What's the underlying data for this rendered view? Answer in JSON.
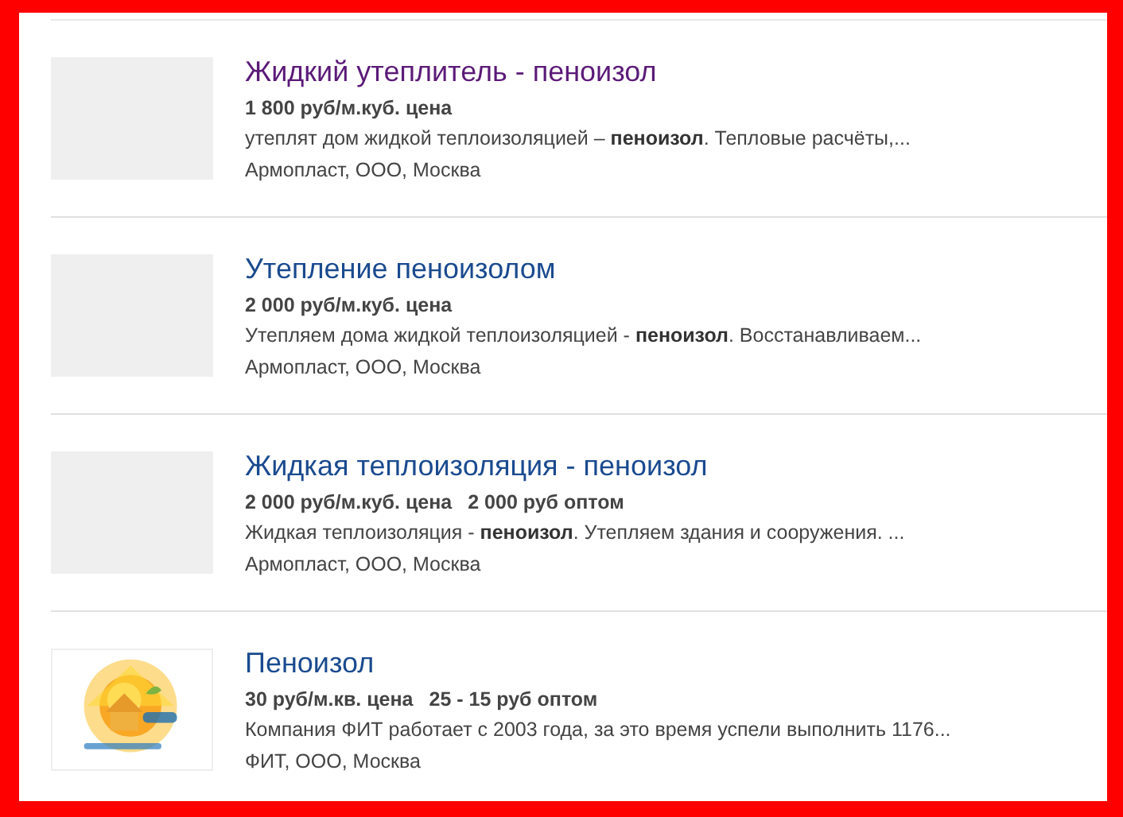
{
  "listings": [
    {
      "thumbnail": {
        "kind": "placeholder"
      },
      "title": "Жидкий утеплитель - пеноизол",
      "visited": true,
      "prices": [
        "1 800 руб/м.куб. цена"
      ],
      "description": "утеплят дом жидкой теплоизоляцией – **пеноизол**. Тепловые расчёты,...",
      "seller": "Армопласт, ООО, Москва"
    },
    {
      "thumbnail": {
        "kind": "placeholder"
      },
      "title": "Утепление пеноизолом",
      "visited": false,
      "prices": [
        "2 000 руб/м.куб. цена"
      ],
      "description": "Утепляем дома жидкой теплоизоляцией - **пеноизол**. Восстанавливаем...",
      "seller": "Армопласт, ООО, Москва"
    },
    {
      "thumbnail": {
        "kind": "placeholder"
      },
      "title": "Жидкая теплоизоляция - пеноизол",
      "visited": false,
      "prices": [
        "2 000 руб/м.куб. цена",
        "2 000 руб оптом"
      ],
      "description": "Жидкая теплоизоляция - **пеноизол**. Утепляем здания и сооружения. ...",
      "seller": "Армопласт, ООО, Москва"
    },
    {
      "title": "Пеноизол",
      "visited": false,
      "prices": [
        "30 руб/м.кв. цена",
        "25 - 15 руб оптом"
      ],
      "description": "Компания ФИТ работает с 2003 года, за это время успели выполнить 1176...",
      "seller": "ФИТ, ООО, Москва"
    }
  ]
}
